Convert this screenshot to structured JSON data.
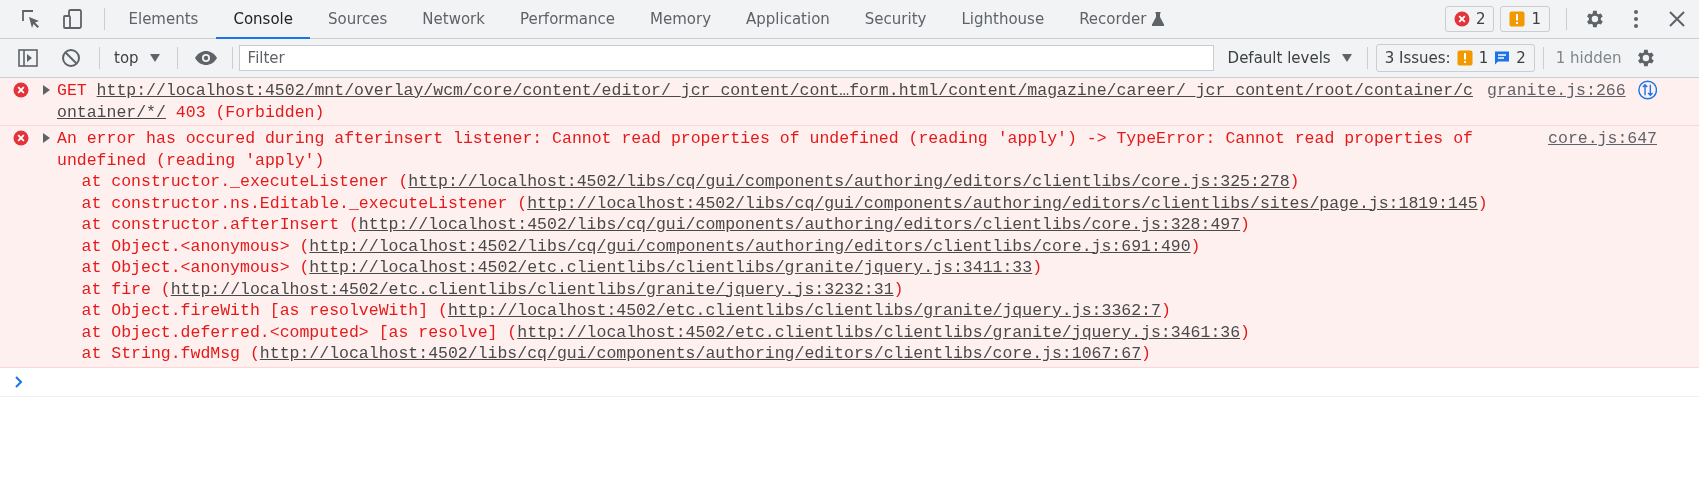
{
  "tabs": [
    {
      "label": "Elements",
      "selected": false
    },
    {
      "label": "Console",
      "selected": true
    },
    {
      "label": "Sources",
      "selected": false
    },
    {
      "label": "Network",
      "selected": false
    },
    {
      "label": "Performance",
      "selected": false
    },
    {
      "label": "Memory",
      "selected": false
    },
    {
      "label": "Application",
      "selected": false
    },
    {
      "label": "Security",
      "selected": false
    },
    {
      "label": "Lighthouse",
      "selected": false
    },
    {
      "label": "Recorder",
      "selected": false,
      "experimental": true
    }
  ],
  "counters": [
    {
      "kind": "error",
      "count": "2"
    },
    {
      "kind": "warning",
      "count": "1"
    }
  ],
  "toolbar": {
    "context": "top",
    "filter": {
      "placeholder": "Filter"
    },
    "levels": "Default levels",
    "issues": {
      "label": "3 Issues:",
      "counts": [
        {
          "kind": "warning",
          "count": "1"
        },
        {
          "kind": "info",
          "count": "2"
        }
      ]
    },
    "hidden": "1 hidden"
  },
  "messages": [
    {
      "kind": "request",
      "error": true,
      "expanded": false,
      "prefix": "GET ",
      "url_parts": [
        "http://localhost:4502/mnt/overlay/wcm/core/content/editor/_jcr_content/cont…form.html/content/magazine/career/_jcr_content/root/container/c",
        "ontainer/*/"
      ],
      "suffix": " 403 (Forbidden)",
      "source": "granite.js:266",
      "network_link": true
    },
    {
      "kind": "exception",
      "error": true,
      "expanded": false,
      "text": "An error has occured during afterinsert listener: Cannot read properties of undefined (reading 'apply') -> TypeError: Cannot read properties of undefined (reading 'apply')",
      "source": "core.js:647",
      "frames": [
        {
          "prefix": "at constructor._executeListener (",
          "url": "http://localhost:4502/libs/cq/gui/components/authoring/editors/clientlibs/core.js:325:278",
          "suffix": ")"
        },
        {
          "prefix": "at constructor.ns.Editable._executeListener (",
          "url": "http://localhost:4502/libs/cq/gui/components/authoring/editors/clientlibs/sites/page.js:1819:145",
          "suffix": ")"
        },
        {
          "prefix": "at constructor.afterInsert (",
          "url": "http://localhost:4502/libs/cq/gui/components/authoring/editors/clientlibs/core.js:328:497",
          "suffix": ")"
        },
        {
          "prefix": "at Object.<anonymous> (",
          "url": "http://localhost:4502/libs/cq/gui/components/authoring/editors/clientlibs/core.js:691:490",
          "suffix": ")"
        },
        {
          "prefix": "at Object.<anonymous> (",
          "url": "http://localhost:4502/etc.clientlibs/clientlibs/granite/jquery.js:3411:33",
          "suffix": ")"
        },
        {
          "prefix": "at fire (",
          "url": "http://localhost:4502/etc.clientlibs/clientlibs/granite/jquery.js:3232:31",
          "suffix": ")"
        },
        {
          "prefix": "at Object.fireWith [as resolveWith] (",
          "url": "http://localhost:4502/etc.clientlibs/clientlibs/granite/jquery.js:3362:7",
          "suffix": ")"
        },
        {
          "prefix": "at Object.deferred.<computed> [as resolve] (",
          "url": "http://localhost:4502/etc.clientlibs/clientlibs/granite/jquery.js:3461:36",
          "suffix": ")"
        },
        {
          "prefix": "at String.fwdMsg (",
          "url": "http://localhost:4502/libs/cq/gui/components/authoring/editors/clientlibs/core.js:1067:67",
          "suffix": ")"
        }
      ]
    }
  ]
}
